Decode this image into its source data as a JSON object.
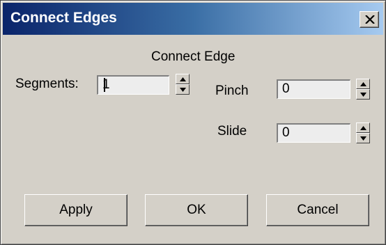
{
  "window": {
    "title": "Connect Edges",
    "close_label": "close"
  },
  "group": {
    "label": "Connect Edge"
  },
  "segments": {
    "label": "Segments:",
    "value": "1"
  },
  "pinch": {
    "label": "Pinch",
    "value": "0"
  },
  "slide": {
    "label": "Slide",
    "value": "0"
  },
  "buttons": {
    "apply": "Apply",
    "ok": "OK",
    "cancel": "Cancel"
  },
  "icons": {
    "close": "close-icon",
    "spin_up": "arrow-up-icon",
    "spin_down": "arrow-down-icon"
  },
  "colors": {
    "titlebar_start": "#0a246a",
    "titlebar_end": "#a6caf0",
    "face": "#d4d0c8"
  }
}
